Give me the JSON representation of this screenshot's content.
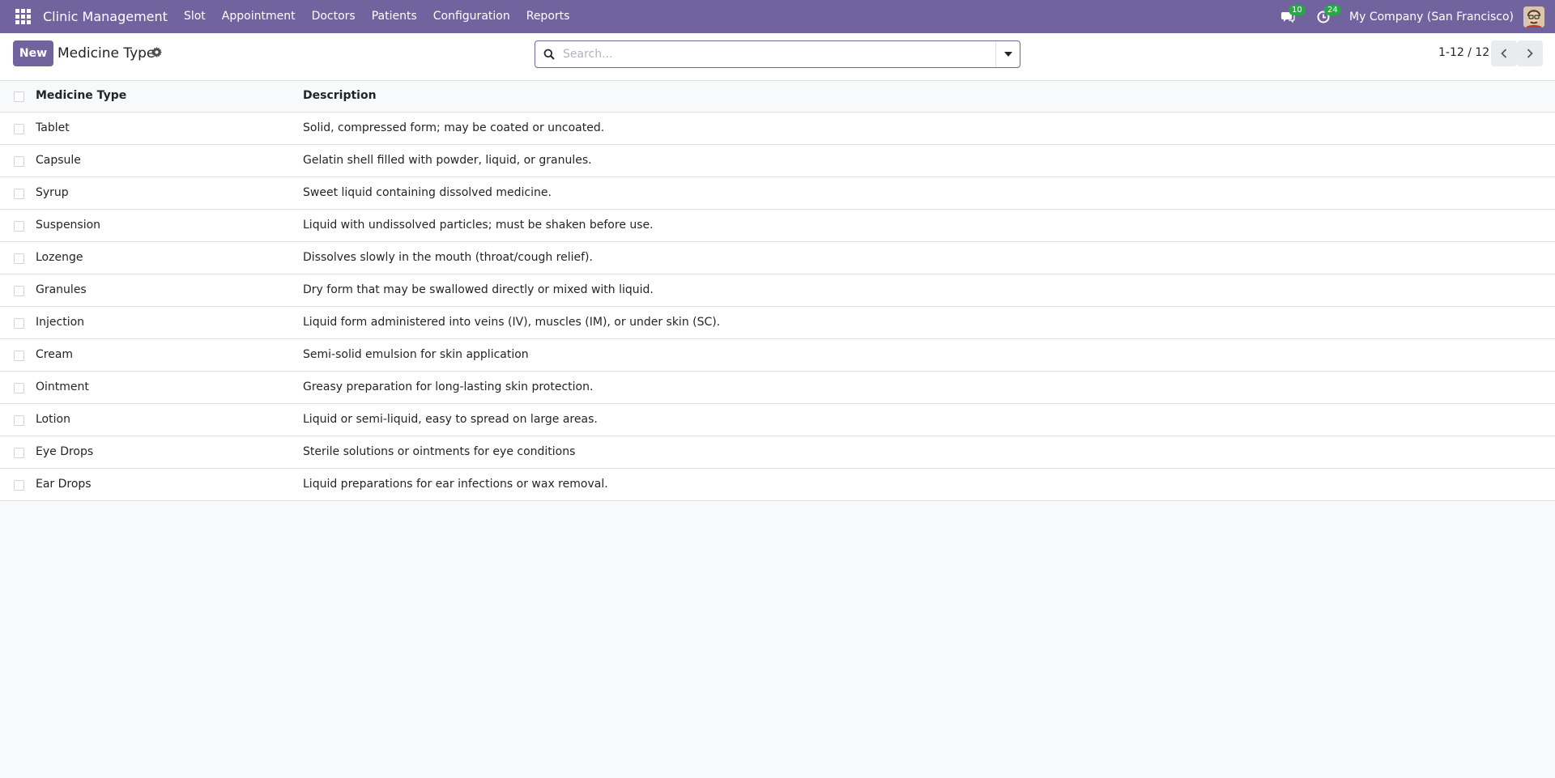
{
  "navbar": {
    "brand": "Clinic Management",
    "menu": [
      "Slot",
      "Appointment",
      "Doctors",
      "Patients",
      "Configuration",
      "Reports"
    ],
    "messages_count": "10",
    "activities_count": "24",
    "company": "My Company (San Francisco)"
  },
  "control": {
    "new_label": "New",
    "title": "Medicine Type",
    "search_placeholder": "Search...",
    "pager": "1-12 / 12"
  },
  "table": {
    "headers": [
      "Medicine Type",
      "Description"
    ],
    "rows": [
      {
        "name": "Tablet",
        "description": "Solid, compressed form; may be coated or uncoated."
      },
      {
        "name": "Capsule",
        "description": "Gelatin shell filled with powder, liquid, or granules."
      },
      {
        "name": "Syrup",
        "description": "Sweet liquid containing dissolved medicine."
      },
      {
        "name": "Suspension",
        "description": "Liquid with undissolved particles; must be shaken before use."
      },
      {
        "name": "Lozenge",
        "description": "Dissolves slowly in the mouth (throat/cough relief)."
      },
      {
        "name": "Granules",
        "description": "Dry form that may be swallowed directly or mixed with liquid."
      },
      {
        "name": "Injection",
        "description": "Liquid form administered into veins (IV), muscles (IM), or under skin (SC)."
      },
      {
        "name": "Cream",
        "description": "Semi-solid emulsion for skin application"
      },
      {
        "name": "Ointment",
        "description": "Greasy preparation for long-lasting skin protection."
      },
      {
        "name": "Lotion",
        "description": "Liquid or semi-liquid, easy to spread on large areas."
      },
      {
        "name": "Eye Drops",
        "description": "Sterile solutions or ointments for eye conditions"
      },
      {
        "name": "Ear Drops",
        "description": "Liquid preparations for ear infections or wax removal."
      }
    ]
  },
  "colors": {
    "brand": "#71639e",
    "badge": "#28a745"
  },
  "icons": {
    "apps": "apps-grid-icon",
    "messages": "chat-icon",
    "activities": "clock-icon",
    "settings": "gear-icon",
    "search": "search-icon",
    "toggle": "caret-down-icon",
    "prev": "chevron-left-icon",
    "next": "chevron-right-icon"
  }
}
